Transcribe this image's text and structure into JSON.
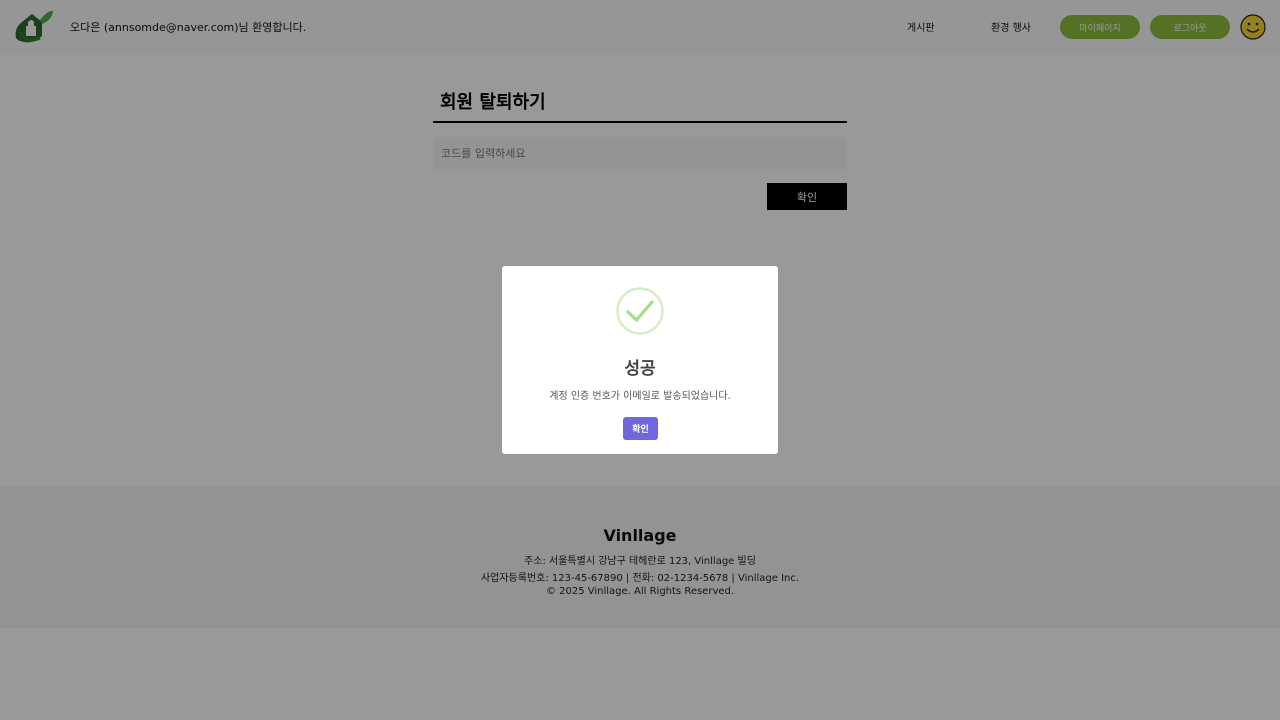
{
  "header": {
    "welcome_text": "오다은 (annsomde@naver.com)님 환영합니다.",
    "nav": [
      {
        "label": "게시판"
      },
      {
        "label": "환경 행사"
      }
    ],
    "mypage_label": "마이페이지",
    "logout_label": "로그아웃",
    "logo_icon": "house-leaf-logo",
    "avatar_icon": "smiley-face-icon"
  },
  "main": {
    "title": "회원 탈퇴하기",
    "code_placeholder": "코드를 입력하세요",
    "code_value": "",
    "confirm_label": "확인"
  },
  "footer": {
    "brand": "Vinllage",
    "address": "주소: 서울특별시 강남구 테헤란로 123, Vinllage 빌딩",
    "business": "사업자등록번호: 123-45-67890 | 전화: 02-1234-5678 | Vinllage Inc.",
    "copyright": "© 2025 Vinllage. All Rights Reserved."
  },
  "modal": {
    "icon": "success-check-icon",
    "title": "성공",
    "message": "계정 인증 번호가 이메일로 발송되었습니다.",
    "confirm_label": "확인"
  },
  "colors": {
    "accent_green": "#8cbd3e",
    "modal_button": "#7066e0",
    "success_green": "#a5dc86"
  }
}
